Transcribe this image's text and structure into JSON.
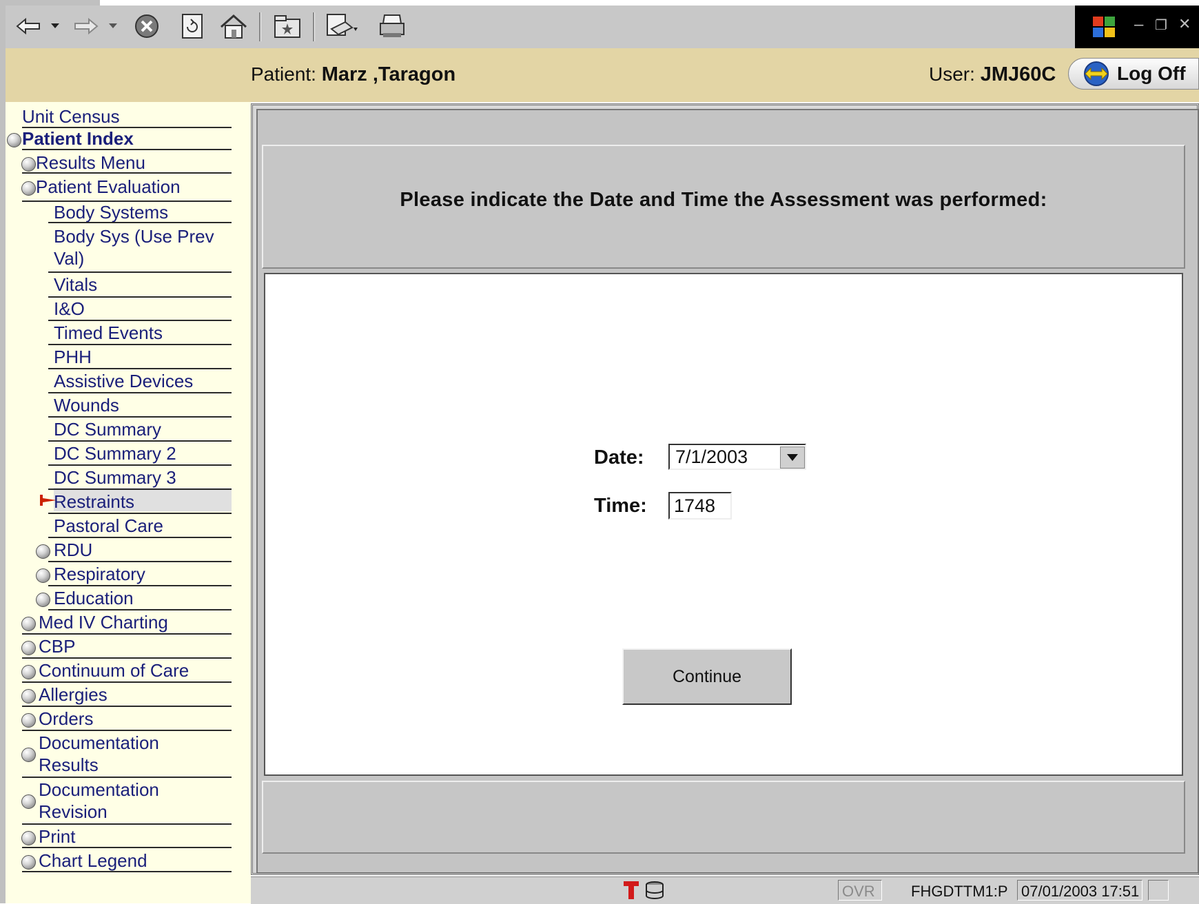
{
  "header": {
    "patient_label": "Patient:",
    "patient_name": "Marz ,Taragon",
    "user_label": "User:",
    "user_id": "JMJ60C",
    "logoff_label": "Log Off"
  },
  "sidebar": {
    "items": [
      {
        "label": "Unit Census"
      },
      {
        "label": "Patient Index"
      },
      {
        "label": "Results Menu"
      },
      {
        "label": "Patient Evaluation"
      },
      {
        "label": "Body Systems"
      },
      {
        "label": "Body Sys (Use Prev",
        "label2": "Val)"
      },
      {
        "label": "Vitals"
      },
      {
        "label": "I&O"
      },
      {
        "label": "Timed Events"
      },
      {
        "label": "PHH"
      },
      {
        "label": "Assistive Devices"
      },
      {
        "label": "Wounds"
      },
      {
        "label": "DC Summary"
      },
      {
        "label": "DC Summary 2"
      },
      {
        "label": "DC Summary 3"
      },
      {
        "label": "Restraints"
      },
      {
        "label": "Pastoral Care"
      },
      {
        "label": "RDU"
      },
      {
        "label": "Respiratory"
      },
      {
        "label": "Education"
      },
      {
        "label": "Med IV Charting"
      },
      {
        "label": "CBP"
      },
      {
        "label": "Continuum of Care"
      },
      {
        "label": "Allergies"
      },
      {
        "label": "Orders"
      },
      {
        "label": "Documentation",
        "label2": "Results"
      },
      {
        "label": "Documentation",
        "label2": "Revision"
      },
      {
        "label": "Print"
      },
      {
        "label": "Chart Legend"
      }
    ]
  },
  "main": {
    "prompt": "Please indicate the Date and Time the Assessment was performed:",
    "date_label": "Date:",
    "date_value": "7/1/2003",
    "time_label": "Time:",
    "time_value": "1748",
    "continue_label": "Continue"
  },
  "statusbar": {
    "ovr": "OVR",
    "station": "FHGDTTM1:P",
    "datetime": "07/01/2003 17:51"
  },
  "icons": {
    "toolbar": [
      "back-icon",
      "forward-icon",
      "stop-icon",
      "refresh-icon",
      "home-icon",
      "favorites-icon",
      "mail-icon",
      "print-icon"
    ],
    "window": [
      "windows-logo-icon",
      "minimize-icon",
      "restore-icon",
      "close-icon"
    ],
    "status": [
      "t-icon",
      "database-icon"
    ]
  },
  "colors": {
    "header_bg": "#e3d5a5",
    "sidebar_bg": "#ffffe6",
    "nav_text": "#1a1f7a",
    "selected_arrow": "#cc2200"
  }
}
